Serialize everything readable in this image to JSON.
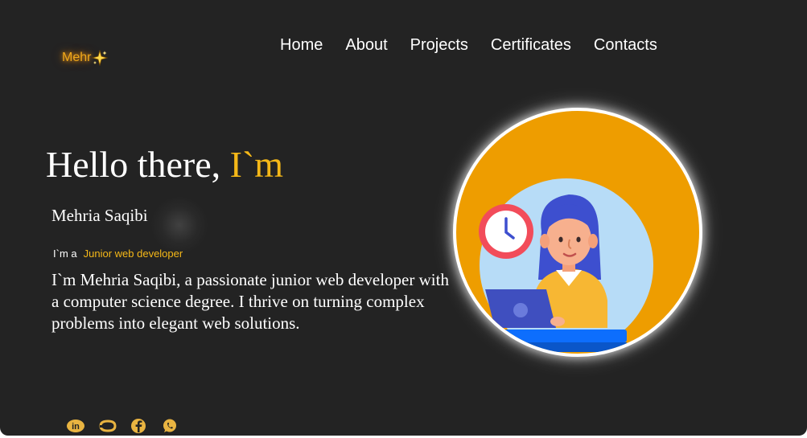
{
  "logo": {
    "text": "Mehr"
  },
  "nav": {
    "items": [
      "Home",
      "About",
      "Projects",
      "Certificates",
      "Contacts"
    ]
  },
  "hero": {
    "hello": "Hello there, ",
    "hello_accent": "I`m",
    "name": "Mehria Saqibi",
    "role_prefix": "I`m a",
    "role": "Junior web developer",
    "bio": "I`m Mehria Saqibi, a passionate junior web developer with a computer science degree. I thrive on turning complex problems into elegant web solutions."
  },
  "colors": {
    "background": "#232323",
    "accent": "#f5b818",
    "avatar_bg": "#ee9d00"
  },
  "socials": [
    "linkedin-icon",
    "github-icon",
    "facebook-icon",
    "whatsapp-icon"
  ]
}
